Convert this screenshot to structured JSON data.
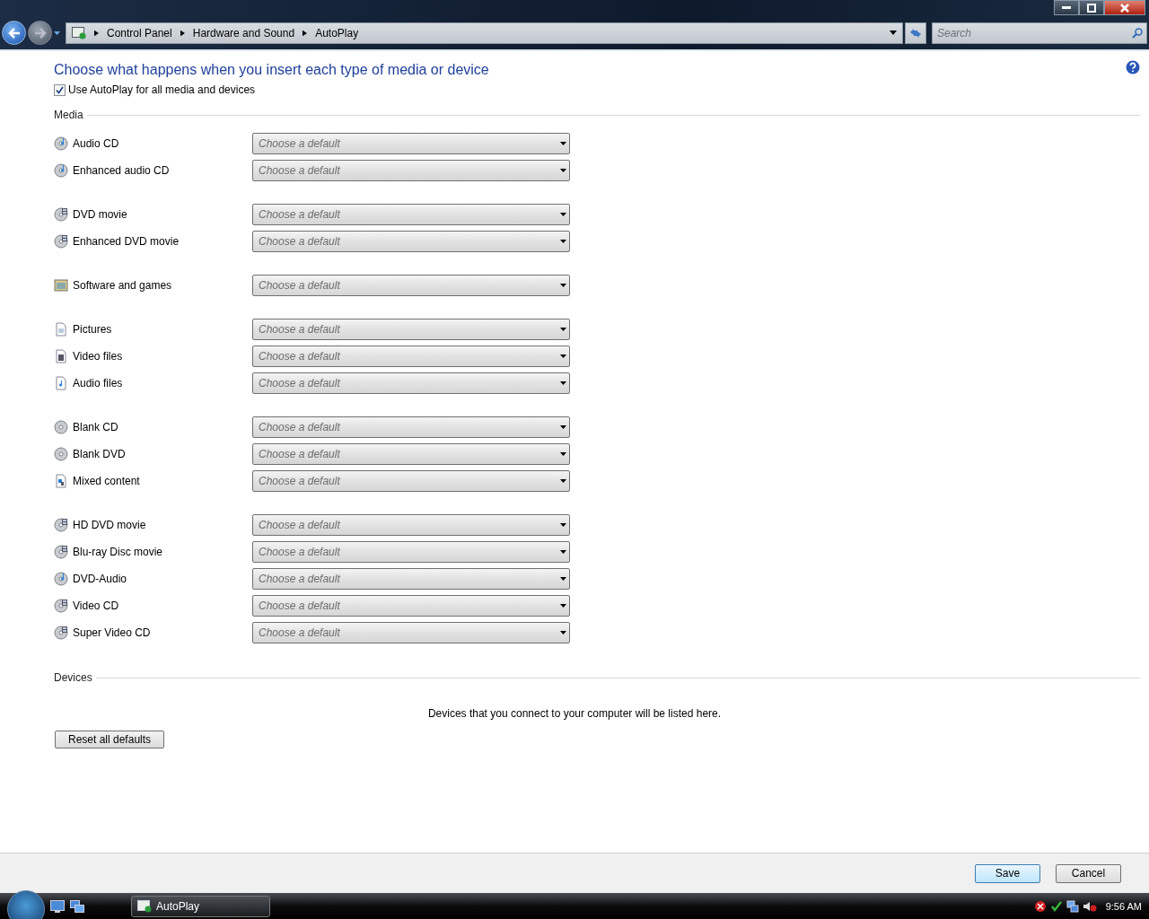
{
  "address_bar": {
    "breadcrumbs": [
      "Control Panel",
      "Hardware and Sound",
      "AutoPlay"
    ]
  },
  "search": {
    "placeholder": "Search"
  },
  "heading": "Choose what happens when you insert each type of media or device",
  "use_autoplay": {
    "label": "Use AutoPlay for all media and devices",
    "checked": true
  },
  "media": {
    "title": "Media",
    "groups": [
      [
        {
          "label": "Audio CD",
          "kind": "music-disc",
          "value": "Choose a default"
        },
        {
          "label": "Enhanced audio CD",
          "kind": "music-disc",
          "value": "Choose a default"
        }
      ],
      [
        {
          "label": "DVD movie",
          "kind": "film-disc",
          "value": "Choose a default"
        },
        {
          "label": "Enhanced DVD movie",
          "kind": "film-disc",
          "value": "Choose a default"
        }
      ],
      [
        {
          "label": "Software and games",
          "kind": "software",
          "value": "Choose a default"
        }
      ],
      [
        {
          "label": "Pictures",
          "kind": "picture-file",
          "value": "Choose a default"
        },
        {
          "label": "Video files",
          "kind": "video-file",
          "value": "Choose a default"
        },
        {
          "label": "Audio files",
          "kind": "audio-file",
          "value": "Choose a default"
        }
      ],
      [
        {
          "label": "Blank CD",
          "kind": "blank-disc",
          "value": "Choose a default"
        },
        {
          "label": "Blank DVD",
          "kind": "blank-disc",
          "value": "Choose a default"
        },
        {
          "label": "Mixed content",
          "kind": "mixed-file",
          "value": "Choose a default"
        }
      ],
      [
        {
          "label": "HD DVD movie",
          "kind": "film-disc",
          "value": "Choose a default"
        },
        {
          "label": "Blu-ray Disc movie",
          "kind": "film-disc",
          "value": "Choose a default"
        },
        {
          "label": "DVD-Audio",
          "kind": "music-disc",
          "value": "Choose a default"
        },
        {
          "label": "Video CD",
          "kind": "film-disc",
          "value": "Choose a default"
        },
        {
          "label": "Super Video CD",
          "kind": "film-disc",
          "value": "Choose a default"
        }
      ]
    ]
  },
  "devices": {
    "title": "Devices",
    "message": "Devices that you connect to your computer will be listed here."
  },
  "reset_button": "Reset all defaults",
  "footer_buttons": [
    {
      "label": "Save",
      "default": true
    },
    {
      "label": "Cancel",
      "default": false
    }
  ],
  "taskbar": {
    "window_button": "AutoPlay",
    "clock": "9:56 AM"
  }
}
